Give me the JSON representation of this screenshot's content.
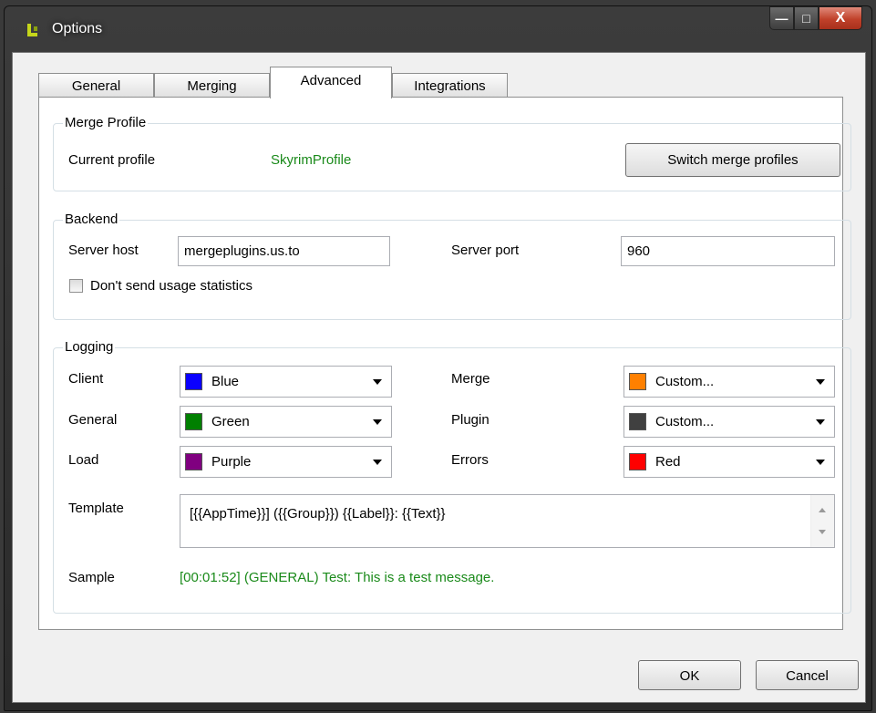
{
  "window": {
    "title": "Options"
  },
  "tabs": [
    "General",
    "Merging",
    "Advanced",
    "Integrations"
  ],
  "merge_profile": {
    "title": "Merge Profile",
    "current_label": "Current profile",
    "current_value": "SkyrimProfile",
    "switch_button": "Switch merge profiles"
  },
  "backend": {
    "title": "Backend",
    "host_label": "Server host",
    "host_value": "mergeplugins.us.to",
    "port_label": "Server port",
    "port_value": "960",
    "stats_checkbox": "Don't send usage statistics",
    "stats_checked": false
  },
  "logging": {
    "title": "Logging",
    "rows": [
      {
        "label": "Client",
        "value": "Blue",
        "color": "#0a00ff"
      },
      {
        "label": "General",
        "value": "Green",
        "color": "#008000"
      },
      {
        "label": "Load",
        "value": "Purple",
        "color": "#800080"
      },
      {
        "label": "Merge",
        "value": "Custom...",
        "color": "#ff8000"
      },
      {
        "label": "Plugin",
        "value": "Custom...",
        "color": "#404040"
      },
      {
        "label": "Errors",
        "value": "Red",
        "color": "#ff0000"
      }
    ],
    "template_label": "Template",
    "template_value": "[{{AppTime}}] ({{Group}}) {{Label}}: {{Text}}",
    "sample_label": "Sample",
    "sample_value": "[00:01:52] (GENERAL) Test: This is a test message."
  },
  "footer": {
    "ok": "OK",
    "cancel": "Cancel"
  },
  "colors": {
    "accent_green": "#1a8a1a"
  }
}
